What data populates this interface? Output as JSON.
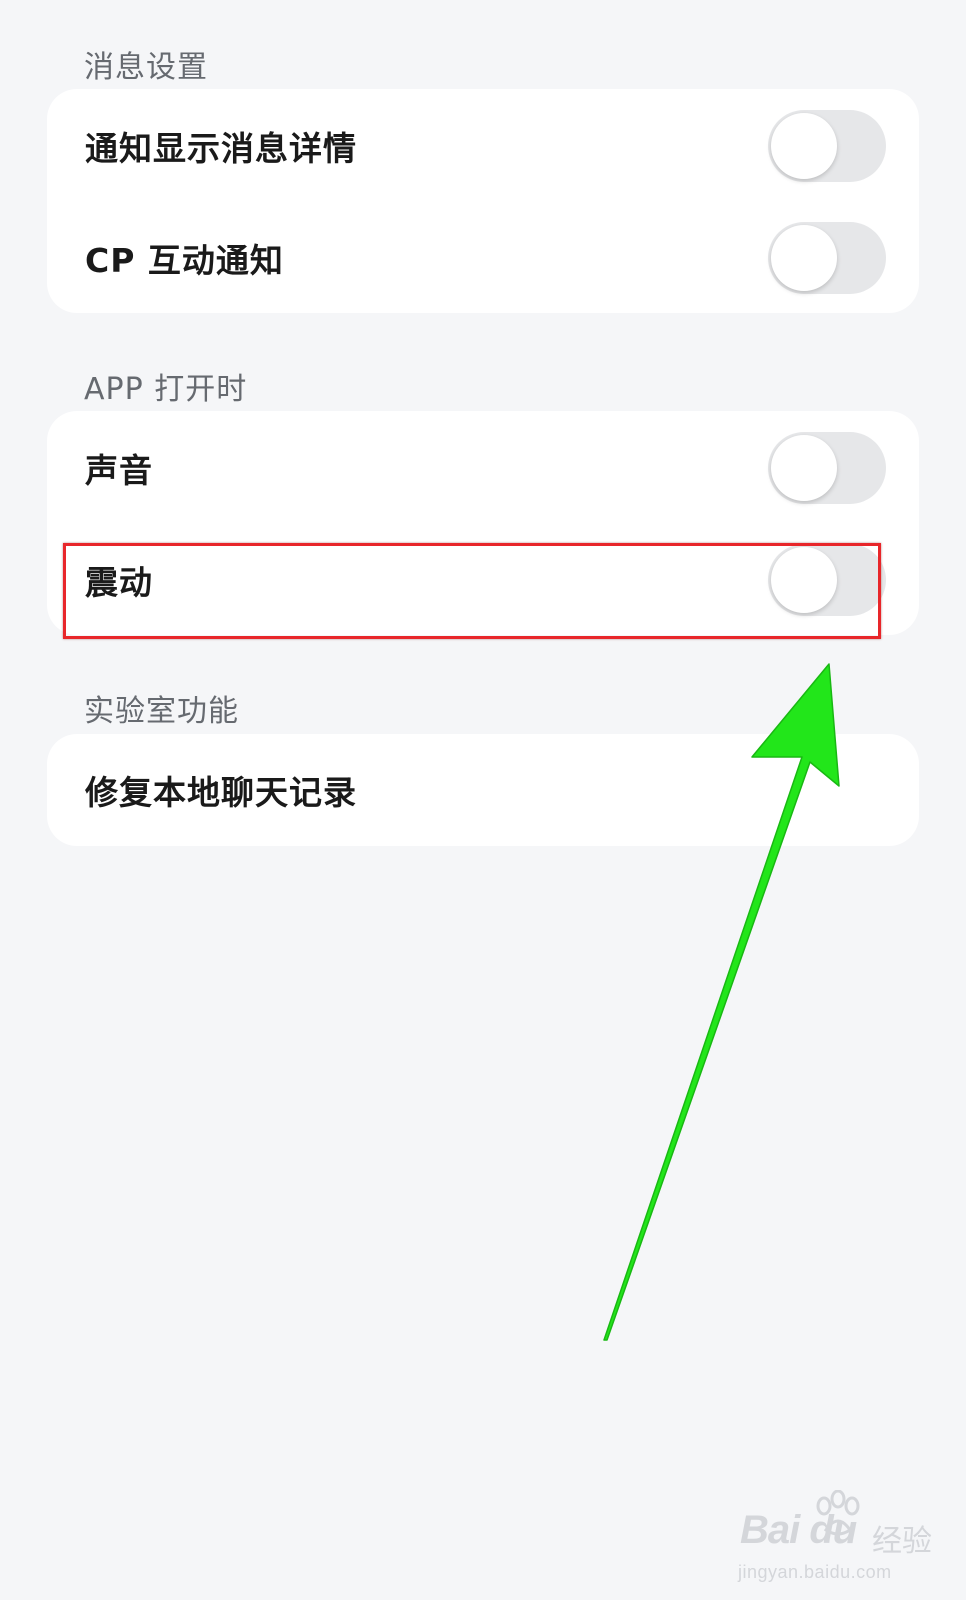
{
  "sections": [
    {
      "label": "消息设置",
      "items": [
        {
          "label": "通知显示消息详情",
          "toggle": false
        },
        {
          "label": "CP 互动通知",
          "toggle": false
        }
      ]
    },
    {
      "label": "APP 打开时",
      "items": [
        {
          "label": "声音",
          "toggle": false
        },
        {
          "label": "震动",
          "toggle": false
        }
      ]
    },
    {
      "label": "实验室功能",
      "items": [
        {
          "label": "修复本地聊天记录"
        }
      ]
    }
  ],
  "annotation": {
    "highlight_color": "#e8262a",
    "arrow_color": "#22e61a"
  },
  "watermark": {
    "brand": "Bai du",
    "suffix": "经验",
    "url": "jingyan.baidu.com"
  },
  "colors": {
    "background": "#f5f6f8",
    "card": "#ffffff",
    "toggle_off": "#e6e7e9",
    "section_label": "#666a70"
  }
}
